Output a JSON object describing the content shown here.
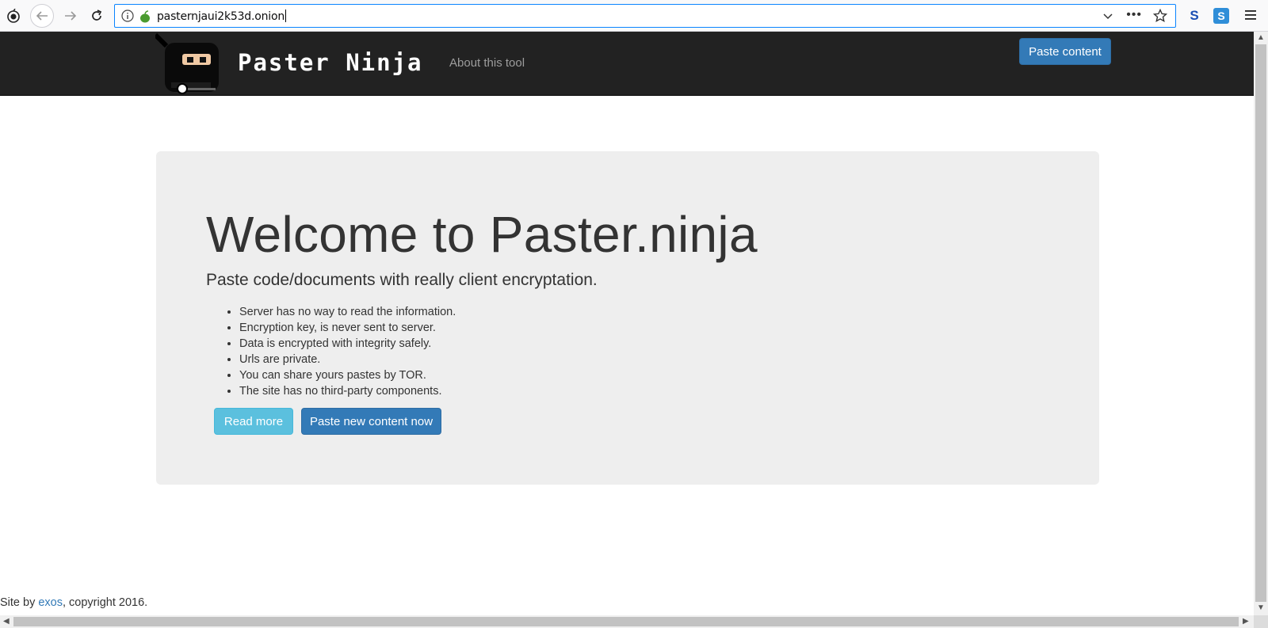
{
  "browser": {
    "url": "pasternjaui2k53d.onion"
  },
  "navbar": {
    "brand": "Paster Ninja",
    "about_link": "About this tool",
    "paste_button": "Paste content"
  },
  "jumbotron": {
    "title": "Welcome to Paster.ninja",
    "lead": "Paste code/documents with really client encryptation.",
    "features": [
      "Server has no way to read the information.",
      "Encryption key, is never sent to server.",
      "Data is encrypted with integrity safely.",
      "Urls are private.",
      "You can share yours pastes by TOR.",
      "The site has no third-party components."
    ],
    "read_more_button": "Read more",
    "paste_new_button": "Paste new content now"
  },
  "footer": {
    "prefix": "Site by ",
    "author_link": "exos",
    "suffix": ", copyright 2016."
  },
  "colors": {
    "navbar_bg": "#222222",
    "primary": "#337ab7",
    "info": "#5bc0de",
    "jumbotron_bg": "#eeeeee"
  }
}
